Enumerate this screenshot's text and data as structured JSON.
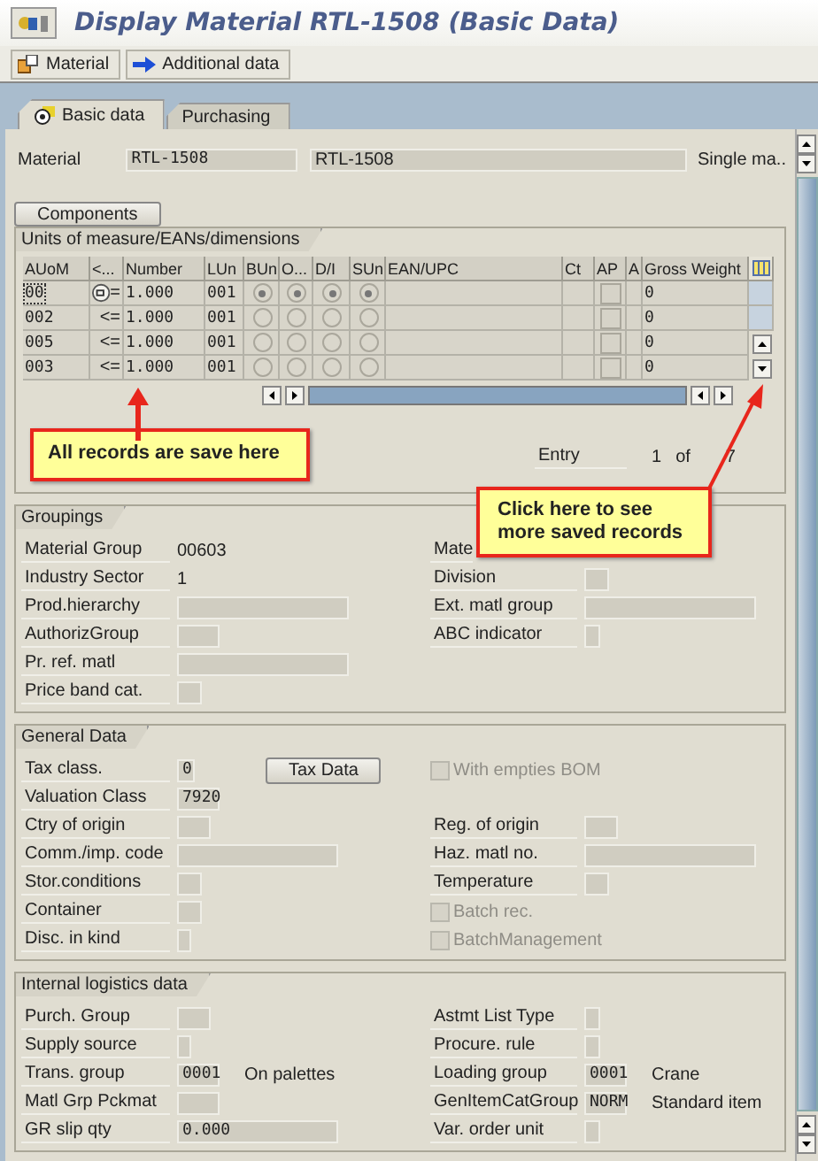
{
  "window": {
    "title": "Display Material RTL-1508 (Basic Data)"
  },
  "toolbar": [
    {
      "label": "Material",
      "kind": "material"
    },
    {
      "label": "Additional data",
      "kind": "forward"
    }
  ],
  "tabs": [
    {
      "label": "Basic data",
      "selected": true
    },
    {
      "label": "Purchasing",
      "selected": false
    }
  ],
  "header": {
    "label": "Material",
    "value": "RTL-1508",
    "description": "RTL-1508",
    "type": "Single ma.."
  },
  "components_button": "Components",
  "uom_table": {
    "title": "Units of measure/EANs/dimensions",
    "columns": [
      "AUoM",
      "<...",
      "Number",
      "LUn",
      "BUn",
      "O...",
      "D/I",
      "SUn",
      "EAN/UPC",
      "Ct",
      "AP",
      "A",
      "Gross Weight"
    ],
    "rows": [
      {
        "auom": "00",
        "focused": true,
        "has_icon": true,
        "rel": "=",
        "number": "1.000",
        "lun": "001",
        "bun": true,
        "o": true,
        "di": true,
        "sun": true,
        "ap": false,
        "gross": "0"
      },
      {
        "auom": "002",
        "focused": false,
        "has_icon": false,
        "rel": "<=",
        "number": "1.000",
        "lun": "001",
        "bun": false,
        "o": false,
        "di": false,
        "sun": false,
        "ap": false,
        "gross": "0"
      },
      {
        "auom": "005",
        "focused": false,
        "has_icon": false,
        "rel": "<=",
        "number": "1.000",
        "lun": "001",
        "bun": false,
        "o": false,
        "di": false,
        "sun": false,
        "ap": false,
        "gross": "0"
      },
      {
        "auom": "003",
        "focused": false,
        "has_icon": false,
        "rel": "<=",
        "number": "1.000",
        "lun": "001",
        "bun": false,
        "o": false,
        "di": false,
        "sun": false,
        "ap": false,
        "gross": "0"
      }
    ],
    "entry": {
      "label": "Entry",
      "current": "1",
      "of": "of",
      "total": "7"
    }
  },
  "callouts": [
    {
      "text": "All records are save here"
    },
    {
      "text": "Click here to see more saved records"
    }
  ],
  "sections": [
    {
      "title": "Groupings",
      "rows": [
        [
          {
            "kind": "text",
            "label": "Material Group",
            "value": "00603"
          },
          {
            "kind": "label",
            "label": "Mate"
          }
        ],
        [
          {
            "kind": "text",
            "label": "Industry Sector",
            "value": "1"
          },
          {
            "kind": "field",
            "label": "Division"
          }
        ],
        [
          {
            "kind": "field",
            "label": "Prod.hierarchy"
          },
          {
            "kind": "field",
            "label": "Ext. matl group"
          }
        ],
        [
          {
            "kind": "field",
            "label": "AuthorizGroup"
          },
          {
            "kind": "field",
            "label": "ABC indicator"
          }
        ],
        [
          {
            "kind": "field",
            "label": "Pr. ref. matl"
          },
          null
        ],
        [
          {
            "kind": "field",
            "label": "Price band cat."
          },
          null
        ]
      ]
    },
    {
      "title": "General Data",
      "rows": [
        [
          {
            "kind": "field",
            "label": "Tax class.",
            "value": "0",
            "button": "Tax Data"
          },
          {
            "kind": "checkbox",
            "label": "With empties BOM",
            "checked": false,
            "disabled": true
          }
        ],
        [
          {
            "kind": "field",
            "label": "Valuation Class",
            "value": "7920"
          },
          null
        ],
        [
          {
            "kind": "field",
            "label": "Ctry of origin"
          },
          {
            "kind": "field",
            "label": "Reg. of origin"
          }
        ],
        [
          {
            "kind": "field",
            "label": "Comm./imp. code"
          },
          {
            "kind": "field",
            "label": "Haz. matl no."
          }
        ],
        [
          {
            "kind": "field",
            "label": "Stor.conditions"
          },
          {
            "kind": "field",
            "label": "Temperature"
          }
        ],
        [
          {
            "kind": "field",
            "label": "Container"
          },
          {
            "kind": "checkbox",
            "label": "Batch rec.",
            "checked": false,
            "disabled": true
          }
        ],
        [
          {
            "kind": "field",
            "label": "Disc. in kind"
          },
          {
            "kind": "checkbox",
            "label": "BatchManagement",
            "checked": false,
            "disabled": true
          }
        ]
      ]
    },
    {
      "title": "Internal logistics data",
      "rows": [
        [
          {
            "kind": "field",
            "label": "Purch. Group"
          },
          {
            "kind": "field",
            "label": "Astmt List Type"
          }
        ],
        [
          {
            "kind": "field",
            "label": "Supply source"
          },
          {
            "kind": "field",
            "label": "Procure. rule"
          }
        ],
        [
          {
            "kind": "field",
            "label": "Trans. group",
            "value": "0001",
            "note": "On palettes"
          },
          {
            "kind": "field",
            "label": "Loading group",
            "value": "0001",
            "note": "Crane"
          }
        ],
        [
          {
            "kind": "field",
            "label": "Matl Grp Pckmat"
          },
          {
            "kind": "field",
            "label": "GenItemCatGroup",
            "value": "NORM",
            "note": "Standard item"
          }
        ],
        [
          {
            "kind": "field",
            "label": "GR slip qty",
            "value": "0.000"
          },
          {
            "kind": "field",
            "label": "Var. order unit"
          }
        ]
      ]
    }
  ]
}
